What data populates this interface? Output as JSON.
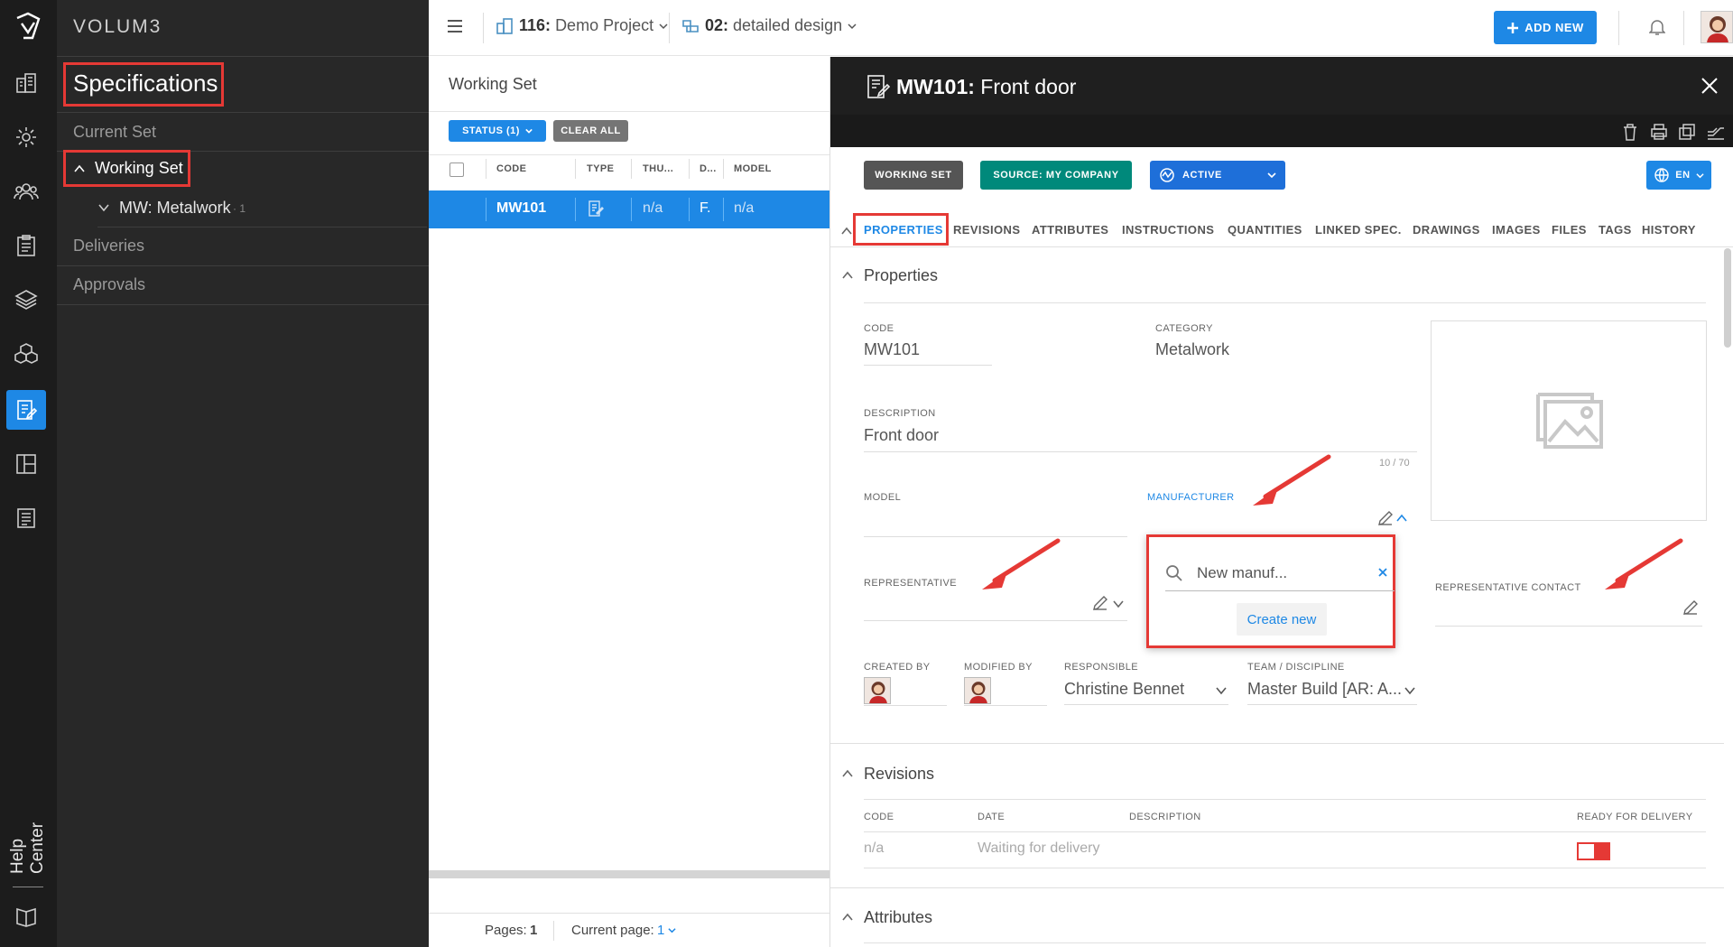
{
  "app": {
    "brand": "VOLUM3"
  },
  "rail": {
    "help_label": "Help Center"
  },
  "sidebar": {
    "title": "Specifications",
    "items": [
      {
        "label": "Current Set"
      },
      {
        "label": "Working Set"
      },
      {
        "label": "MW: Metalwork",
        "count": "· 1"
      },
      {
        "label": "Deliveries"
      },
      {
        "label": "Approvals"
      }
    ]
  },
  "topbar": {
    "project_code": "116:",
    "project_name": "Demo Project",
    "phase_code": "02:",
    "phase_name": "detailed design",
    "add_new": "ADD NEW"
  },
  "list": {
    "title": "Working Set",
    "status_chip": "STATUS (1)",
    "clear_all": "CLEAR ALL",
    "columns": [
      "CODE",
      "TYPE",
      "THU...",
      "D...",
      "MODEL"
    ],
    "row": {
      "code": "MW101",
      "thumb": "n/a",
      "d": "F.",
      "model": "n/a"
    },
    "pages_label": "Pages:",
    "pages_value": "1",
    "current_page_label": "Current page:",
    "current_page_value": "1"
  },
  "detail": {
    "code": "MW101:",
    "name": "Front door",
    "working_set": "WORKING SET",
    "source": "SOURCE: MY COMPANY",
    "status": "ACTIVE",
    "language": "EN",
    "tabs": [
      "PROPERTIES",
      "REVISIONS",
      "ATTRIBUTES",
      "INSTRUCTIONS",
      "QUANTITIES",
      "LINKED SPEC.",
      "DRAWINGS",
      "IMAGES",
      "FILES",
      "TAGS",
      "HISTORY"
    ],
    "properties": {
      "heading": "Properties",
      "code_label": "CODE",
      "code_value": "MW101",
      "category_label": "CATEGORY",
      "category_value": "Metalwork",
      "description_label": "DESCRIPTION",
      "description_value": "Front door",
      "char_count": "10 / 70",
      "model_label": "MODEL",
      "manufacturer_label": "MANUFACTURER",
      "representative_label": "REPRESENTATIVE",
      "rep_contact_label": "REPRESENTATIVE CONTACT",
      "search_value": "New manuf...",
      "create_new": "Create new",
      "created_by_label": "CREATED BY",
      "modified_by_label": "MODIFIED BY",
      "responsible_label": "RESPONSIBLE",
      "responsible_value": "Christine Bennet",
      "team_label": "TEAM / DISCIPLINE",
      "team_value": "Master Build [AR: A..."
    },
    "revisions": {
      "heading": "Revisions",
      "columns": [
        "CODE",
        "DATE",
        "DESCRIPTION",
        "READY FOR DELIVERY"
      ],
      "row": {
        "code": "n/a",
        "date": "Waiting for delivery",
        "description": "",
        "ready": false
      }
    },
    "attributes": {
      "heading": "Attributes"
    }
  },
  "colors": {
    "accent": "#1e88e5",
    "dark": "#1f1f1f",
    "sidebar": "#282828",
    "highlight": "#e53935",
    "source_tag": "#00897b",
    "status_tag": "#1e6fd9"
  }
}
